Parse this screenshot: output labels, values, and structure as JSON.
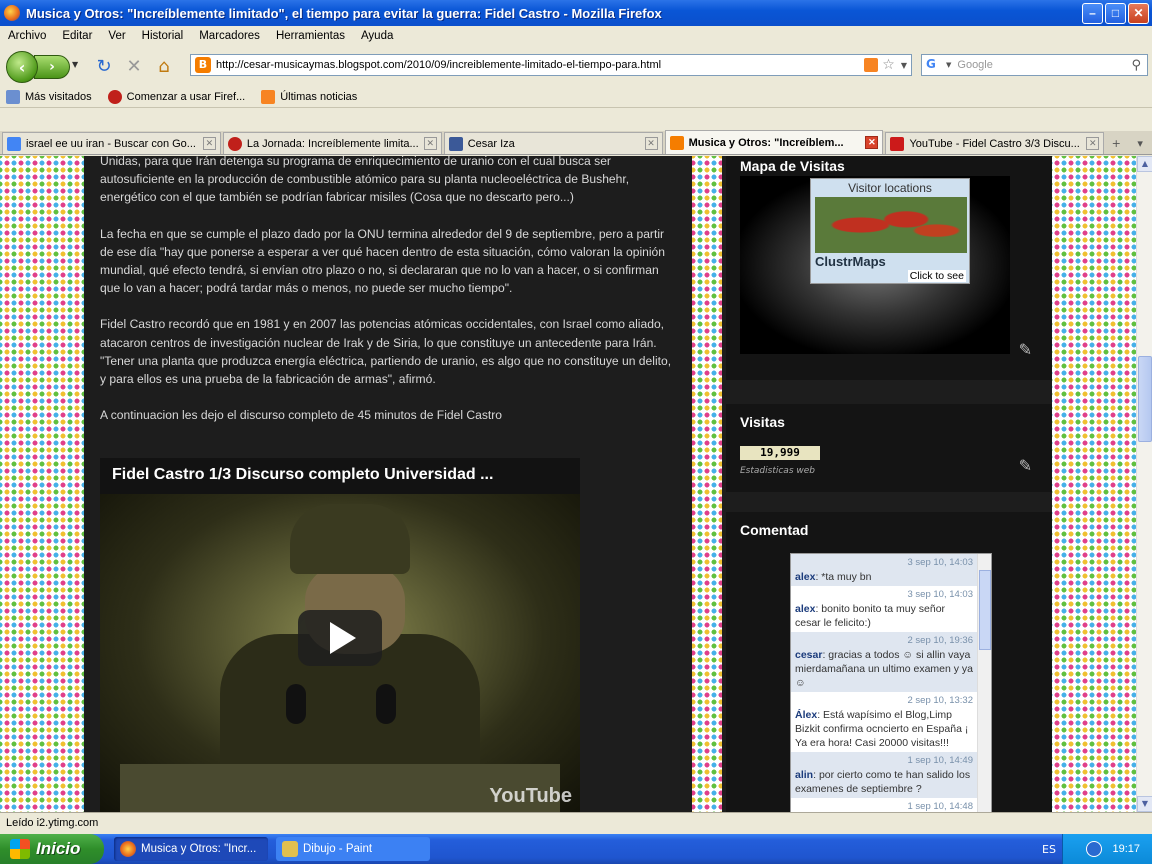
{
  "window": {
    "title": "Musica y Otros: \"Increíblemente limitado\", el tiempo para evitar la guerra: Fidel Castro - Mozilla Firefox"
  },
  "menu": [
    "Archivo",
    "Editar",
    "Ver",
    "Historial",
    "Marcadores",
    "Herramientas",
    "Ayuda"
  ],
  "nav": {
    "url": "http://cesar-musicaymas.blogspot.com/2010/09/increiblemente-limitado-el-tiempo-para.html",
    "search_placeholder": "Google"
  },
  "bookmarks": [
    "Más visitados",
    "Comenzar a usar Firef...",
    "Últimas noticias"
  ],
  "tabs": [
    {
      "label": "israel ee uu iran - Buscar con Go...",
      "color": "#4285f4"
    },
    {
      "label": "La Jornada: Increíblemente limita...",
      "color": "#c0201a"
    },
    {
      "label": "Cesar Iza",
      "color": "#3b5998"
    },
    {
      "label": "Musica y Otros: \"Increíblem...",
      "color": "#f57d00"
    },
    {
      "label": "YouTube - Fidel Castro 3/3 Discu...",
      "color": "#cc1a1a"
    }
  ],
  "post": {
    "p1": "Unidas, para que Irán detenga su programa de enriquecimiento de uranio con el cual busca ser autosuficiente en la producción de combustible atómico para su planta nucleoeléctrica de Bushehr, energético con el que también se podrían fabricar misiles (Cosa que no descarto pero...)",
    "p2": "La fecha en que se cumple el plazo dado por la ONU termina alrededor del 9 de septiembre, pero a partir de ese día \"hay que ponerse a esperar a ver qué hacen dentro de esta situación, cómo valoran la opinión mundial, qué efecto tendrá, si envían otro plazo o no, si declararan que no lo van a hacer, o si confirman que lo van a hacer; podrá tardar más o menos, no puede ser mucho tiempo\".",
    "p3": "Fidel Castro recordó que en 1981 y en 2007 las potencias atómicas occidentales, con Israel como aliado, atacaron centros de investigación nuclear de Irak y de Siria, lo que constituye un antecedente para Irán. \"Tener una planta que produzca energía eléctrica, partiendo de uranio, es algo que no constituye un delito, y para ellos es una prueba de la fabricación de armas\", afirmó.",
    "p4": "A continuacion les dejo el discurso completo de 45 minutos de Fidel Castro"
  },
  "video": {
    "title": "Fidel Castro 1/3 Discurso completo Universidad ...",
    "logo": "YouTube"
  },
  "sidebar": {
    "map": {
      "title": "Mapa de Visitas",
      "map_title": "Visitor locations",
      "brand": "ClustrMaps",
      "click": "Click to see"
    },
    "visits": {
      "title": "Visitas",
      "count": "19,999",
      "label": "Estadisticas web"
    },
    "comments": {
      "title": "Comentad",
      "messages": [
        {
          "date": "3 sep 10, 14:03",
          "who": "alex",
          "text": "*ta muy bn"
        },
        {
          "date": "3 sep 10, 14:03",
          "who": "alex",
          "text": "bonito bonito ta muy señor cesar le felicito:)"
        },
        {
          "date": "2 sep 10, 19:36",
          "who": "cesar",
          "text": "gracias a todos ☺ si allin vaya mierdamañana un ultimo examen y ya ☺"
        },
        {
          "date": "2 sep 10, 13:32",
          "who": "Álex",
          "text": "Está wapísimo el Blog,Limp Bizkit confirma ocncierto en España ¡ Ya era hora! Casi 20000 visitas!!!"
        },
        {
          "date": "1 sep 10, 14:49",
          "who": "alin",
          "text": "por cierto como te han salido los examenes de septiembre ?"
        },
        {
          "date": "1 sep 10, 14:48",
          "who": "",
          "text": ""
        }
      ]
    }
  },
  "status": "Leído i2.ytimg.com",
  "taskbar": {
    "start": "Inicio",
    "tasks": [
      "Musica y Otros: \"Incr...",
      "Dibujo - Paint"
    ],
    "lang": "ES",
    "clock": "19:17"
  }
}
